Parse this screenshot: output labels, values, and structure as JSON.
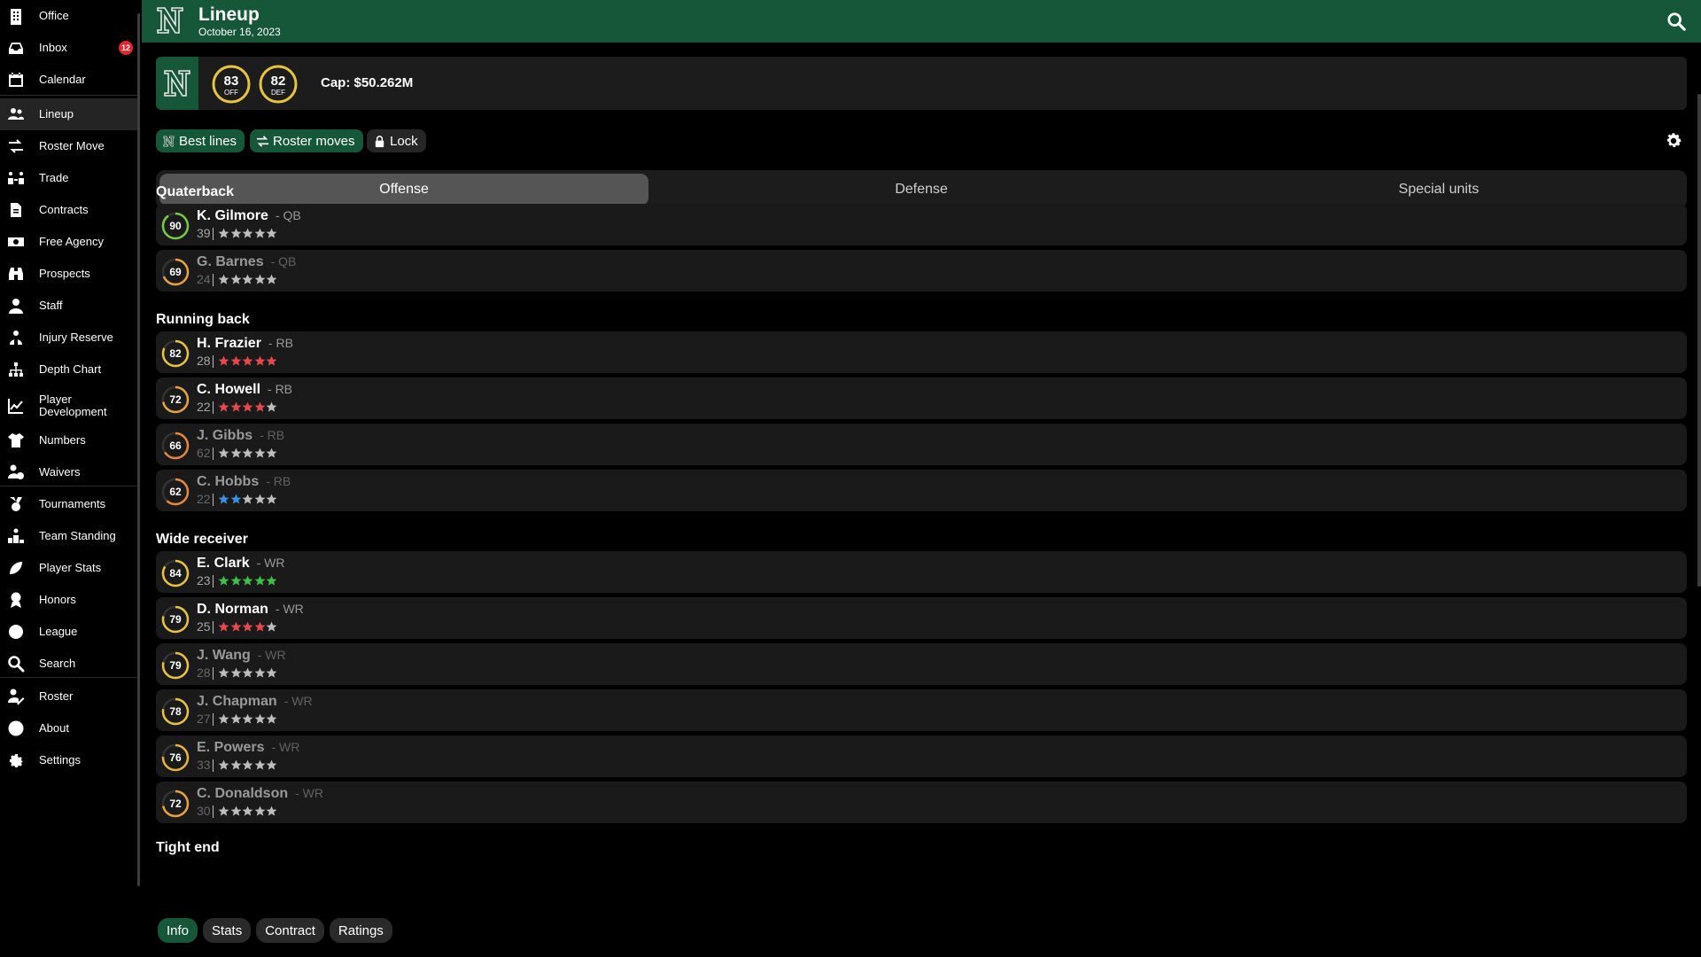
{
  "sidebar": {
    "items": [
      {
        "label": "Office",
        "icon": "building-icon"
      },
      {
        "label": "Inbox",
        "icon": "inbox-icon",
        "badge": "12"
      },
      {
        "label": "Calendar",
        "icon": "calendar-icon"
      },
      {
        "label": "Lineup",
        "icon": "users-icon",
        "active": true
      },
      {
        "label": "Roster Move",
        "icon": "swap-icon"
      },
      {
        "label": "Trade",
        "icon": "trade-icon"
      },
      {
        "label": "Contracts",
        "icon": "contract-icon"
      },
      {
        "label": "Free Agency",
        "icon": "money-icon"
      },
      {
        "label": "Prospects",
        "icon": "binoculars-icon"
      },
      {
        "label": "Staff",
        "icon": "staff-icon"
      },
      {
        "label": "Injury Reserve",
        "icon": "injury-icon"
      },
      {
        "label": "Depth Chart",
        "icon": "hierarchy-icon"
      },
      {
        "label": "Player Development",
        "icon": "chart-line-icon"
      },
      {
        "label": "Numbers",
        "icon": "jersey-icon"
      },
      {
        "label": "Waivers",
        "icon": "user-clock-icon"
      },
      {
        "label": "Tournaments",
        "icon": "medal-icon"
      },
      {
        "label": "Team Standing",
        "icon": "podium-icon"
      },
      {
        "label": "Player Stats",
        "icon": "football-icon"
      },
      {
        "label": "Honors",
        "icon": "award-icon"
      },
      {
        "label": "League",
        "icon": "globe-icon"
      },
      {
        "label": "Search",
        "icon": "search-icon"
      },
      {
        "label": "Roster",
        "icon": "user-edit-icon"
      },
      {
        "label": "About",
        "icon": "info-icon"
      },
      {
        "label": "Settings",
        "icon": "gear-icon"
      }
    ]
  },
  "header": {
    "title": "Lineup",
    "date": "October 16, 2023"
  },
  "team": {
    "off_rating": "83",
    "off_label": "OFF",
    "def_rating": "82",
    "def_label": "DEF",
    "cap": "Cap: $50.262M"
  },
  "toolbar": {
    "best_lines": "Best lines",
    "roster_moves": "Roster moves",
    "lock": "Lock"
  },
  "tabs": [
    "Offense",
    "Defense",
    "Special units"
  ],
  "active_tab": "Offense",
  "sections": [
    {
      "title": "Quaterback",
      "players": [
        {
          "ovr": 90,
          "name": "K. Gilmore",
          "pos": "- QB",
          "age": "39",
          "stars": 5,
          "star_color": "#bdbdbd",
          "ring": "#7ac943",
          "faded": false
        },
        {
          "ovr": 69,
          "name": "G. Barnes",
          "pos": "- QB",
          "age": "24",
          "stars": 2.5,
          "star_color": "#bdbdbd",
          "ring": "#e8a33d",
          "faded": true
        }
      ]
    },
    {
      "title": "Running back",
      "players": [
        {
          "ovr": 82,
          "name": "H. Frazier",
          "pos": "- RB",
          "age": "28",
          "stars": 5,
          "star_color": "#e5484d",
          "ring": "#e8c33d",
          "faded": false
        },
        {
          "ovr": 72,
          "name": "C. Howell",
          "pos": "- RB",
          "age": "22",
          "stars": 4,
          "star_color": "#e5484d",
          "ring": "#e8a33d",
          "faded": false
        },
        {
          "ovr": 66,
          "name": "J. Gibbs",
          "pos": "- RB",
          "age": "62",
          "stars": 3,
          "star_color": "#bdbdbd",
          "ring": "#e8863d",
          "faded": true
        },
        {
          "ovr": 62,
          "name": "C. Hobbs",
          "pos": "- RB",
          "age": "22",
          "stars": 2,
          "star_color": "#3b8fe0",
          "ring": "#e8863d",
          "faded": true
        }
      ]
    },
    {
      "title": "Wide receiver",
      "players": [
        {
          "ovr": 84,
          "name": "E. Clark",
          "pos": "- WR",
          "age": "23",
          "stars": 5,
          "star_color": "#3fbf4a",
          "ring": "#e8c33d",
          "faded": false
        },
        {
          "ovr": 79,
          "name": "D. Norman",
          "pos": "- WR",
          "age": "25",
          "stars": 4,
          "star_color": "#e5484d",
          "ring": "#e8c33d",
          "faded": false
        },
        {
          "ovr": 79,
          "name": "J. Wang",
          "pos": "- WR",
          "age": "28",
          "stars": 5,
          "star_color": "#bdbdbd",
          "ring": "#e8c33d",
          "faded": true
        },
        {
          "ovr": 78,
          "name": "J. Chapman",
          "pos": "- WR",
          "age": "27",
          "stars": 3,
          "star_color": "#bdbdbd",
          "ring": "#e8c33d",
          "faded": true
        },
        {
          "ovr": 76,
          "name": "E. Powers",
          "pos": "- WR",
          "age": "33",
          "stars": 5,
          "star_color": "#bdbdbd",
          "ring": "#e8b33d",
          "faded": true
        },
        {
          "ovr": 72,
          "name": "C. Donaldson",
          "pos": "- WR",
          "age": "30",
          "stars": 5,
          "star_color": "#bdbdbd",
          "ring": "#e8a33d",
          "faded": true
        }
      ]
    },
    {
      "title": "Tight end",
      "players": []
    }
  ],
  "bottom_tabs": [
    "Info",
    "Stats",
    "Contract",
    "Ratings"
  ],
  "colors": {
    "brand": "#16573a",
    "badge": "#e3262f"
  }
}
